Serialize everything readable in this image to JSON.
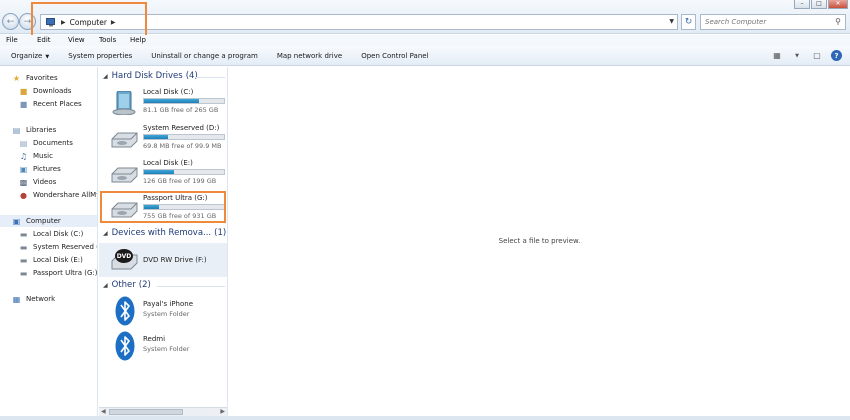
{
  "address_bar": {
    "crumbs": [
      "Computer"
    ]
  },
  "search": {
    "placeholder": "Search Computer"
  },
  "menu": [
    "File",
    "Edit",
    "View",
    "Tools",
    "Help"
  ],
  "commands": {
    "organize": "Organize",
    "system_properties": "System properties",
    "uninstall": "Uninstall or change a program",
    "map_drive": "Map network drive",
    "control_panel": "Open Control Panel"
  },
  "nav": {
    "favorites": "Favorites",
    "downloads": "Downloads",
    "recent": "Recent Places",
    "libraries": "Libraries",
    "documents": "Documents",
    "music": "Music",
    "pictures": "Pictures",
    "videos": "Videos",
    "wondershare": "Wondershare AllMyT",
    "computer": "Computer",
    "local_c": "Local Disk (C:)",
    "reserved_d": "System Reserved (D:",
    "local_e": "Local Disk (E:)",
    "passport_g": "Passport Ultra (G:)",
    "network": "Network"
  },
  "groups": {
    "hdd": {
      "title": "Hard Disk Drives",
      "count": "(4)"
    },
    "removable": {
      "title": "Devices with Remova...",
      "count": "(1)"
    },
    "other": {
      "title": "Other",
      "count": "(2)"
    }
  },
  "drives": [
    {
      "name": "Local Disk (C:)",
      "free": "81.1 GB free of 265 GB",
      "used_fraction": 0.69
    },
    {
      "name": "System Reserved (D:)",
      "free": "69.8 MB free of 99.9 MB",
      "used_fraction": 0.3
    },
    {
      "name": "Local Disk (E:)",
      "free": "126 GB free of 199 GB",
      "used_fraction": 0.37
    },
    {
      "name": "Passport Ultra (G:)",
      "free": "755 GB free of 931 GB",
      "used_fraction": 0.19
    }
  ],
  "devices": [
    {
      "name": "DVD RW Drive (F:)"
    }
  ],
  "other": [
    {
      "name": "Payal's iPhone",
      "type": "System Folder"
    },
    {
      "name": "Redmi",
      "type": "System Folder"
    }
  ],
  "preview": {
    "message": "Select a file to preview."
  },
  "colors": {
    "highlight": "#ef8a3c",
    "bar": "#2a91c6",
    "group_title": "#1e3a78"
  }
}
